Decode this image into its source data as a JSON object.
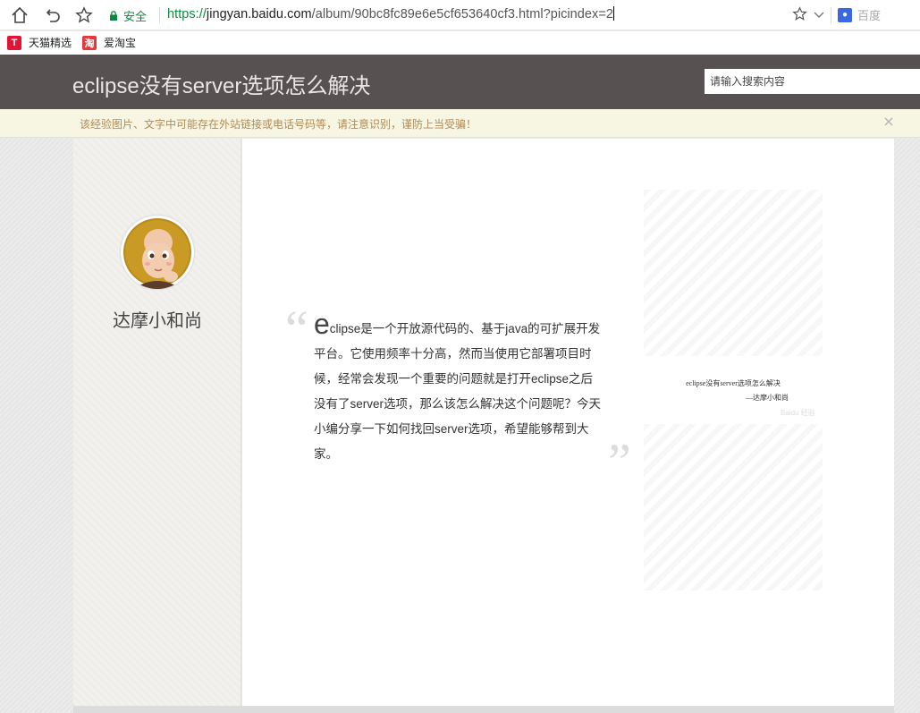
{
  "browser": {
    "secure_label": "安全",
    "url_proto": "https://",
    "url_host": "jingyan.baidu.com",
    "url_path": "/album/90bc8fc89e6e5cf653640cf3.html?picindex=2",
    "search_engine_label": "百度"
  },
  "bookmarks": [
    {
      "label": "天猫精选",
      "icon": "tmall-icon",
      "icon_char": "T",
      "color": "#e31436"
    },
    {
      "label": "爱淘宝",
      "icon": "aitaobao-icon",
      "icon_char": "淘",
      "color": "#e4393c"
    }
  ],
  "header": {
    "title": "eclipse没有server选项怎么解决",
    "search_placeholder": "请输入搜索内容"
  },
  "notice": {
    "text": "该经验图片、文字中可能存在外站链接或电话号码等，请注意识别，谨防上当受骗！",
    "close": "×"
  },
  "sidebar": {
    "author": "达摩小和尚"
  },
  "content": {
    "quote_open": "“",
    "quote_close": "”",
    "dropcap": "e",
    "intro": "clipse是一个开放源代码的、基于java的可扩展开发平台。它使用频率十分高，然而当使用它部署项目时候，经常会发现一个重要的问题就是打开eclipse之后没有了server选项，那么该怎么解决这个问题呢？今天小编分享一下如何找回server选项，希望能够帮到大家。"
  },
  "cover": {
    "title": "eclipse没有server选项怎么解决",
    "author": "—达摩小和尚",
    "watermark": "Baidu 经验"
  },
  "colors": {
    "header_bg": "#575251",
    "notice_bg": "#f7f6e2",
    "secure_green": "#0b8a3e"
  }
}
